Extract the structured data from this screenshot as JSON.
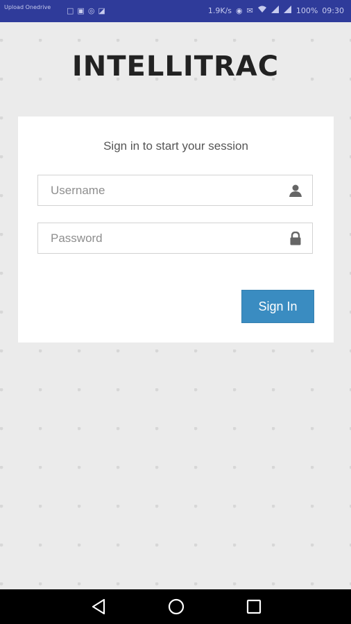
{
  "status_bar": {
    "notification_text": "Upload Onedrive",
    "left_icons": [
      "□",
      "▣",
      "◎",
      "◪"
    ],
    "right_items": [
      "1.9K/s",
      "◉",
      "✉",
      "wifi",
      "signal",
      "signal",
      "100%",
      "09:30"
    ]
  },
  "app": {
    "brand": "INTELLITRAC"
  },
  "login_card": {
    "subtitle": "Sign in to start your session",
    "username_placeholder": "Username",
    "password_placeholder": "Password",
    "username_icon": "user-icon",
    "password_icon": "lock-icon",
    "signin_label": "Sign In"
  },
  "nav_bar": {
    "buttons": [
      "back",
      "home",
      "recents"
    ]
  },
  "colors": {
    "status_bar": "#2f3b9a",
    "background": "#ebebeb",
    "card": "#ffffff",
    "button": "#3a8cc1",
    "brand_text": "#222222"
  }
}
